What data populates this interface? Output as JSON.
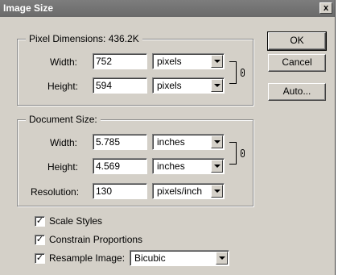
{
  "window": {
    "title": "Image Size",
    "close_glyph": "x"
  },
  "pixel_dimensions": {
    "legend": "Pixel Dimensions:  436.2K",
    "width_label": "Width:",
    "width_value": "752",
    "width_unit": "pixels",
    "height_label": "Height:",
    "height_value": "594",
    "height_unit": "pixels"
  },
  "document_size": {
    "legend": "Document Size:",
    "width_label": "Width:",
    "width_value": "5.785",
    "width_unit": "inches",
    "height_label": "Height:",
    "height_value": "4.569",
    "height_unit": "inches",
    "resolution_label": "Resolution:",
    "resolution_value": "130",
    "resolution_unit": "pixels/inch"
  },
  "buttons": {
    "ok": "OK",
    "cancel": "Cancel",
    "auto": "Auto..."
  },
  "options": {
    "scale_styles": {
      "label": "Scale Styles",
      "checked": true
    },
    "constrain": {
      "label": "Constrain Proportions",
      "checked": true
    },
    "resample": {
      "label": "Resample Image:",
      "checked": true,
      "method": "Bicubic"
    }
  },
  "check_glyph": "✓"
}
